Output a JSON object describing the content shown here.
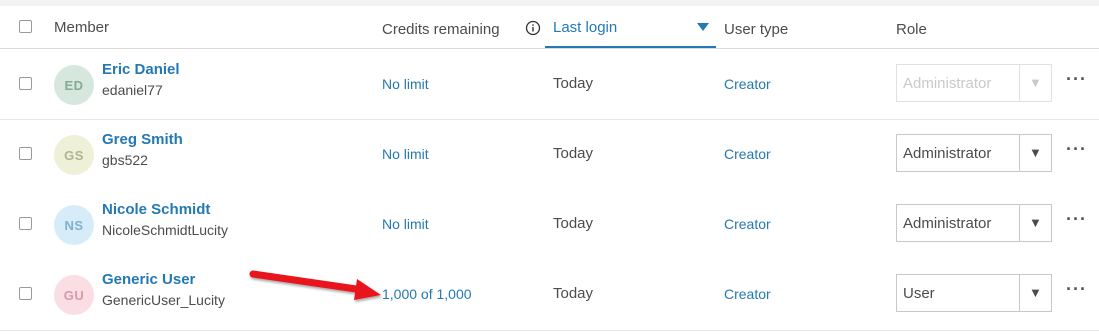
{
  "header": {
    "member": "Member",
    "credits_remaining": "Credits remaining",
    "last_login": "Last login",
    "user_type": "User type",
    "role": "Role"
  },
  "members": [
    {
      "initials": "ED",
      "full_name": "Eric Daniel",
      "username": "edaniel77",
      "credits": "No limit",
      "last_login": "Today",
      "user_type": "Creator",
      "role": "Administrator",
      "role_disabled": true,
      "avatar_bg": "#d6e8dd",
      "avatar_fg": "#86a994"
    },
    {
      "initials": "GS",
      "full_name": "Greg Smith",
      "username": "gbs522",
      "credits": "No limit",
      "last_login": "Today",
      "user_type": "Creator",
      "role": "Administrator",
      "role_disabled": false,
      "avatar_bg": "#eef0d8",
      "avatar_fg": "#b0b48f"
    },
    {
      "initials": "NS",
      "full_name": "Nicole Schmidt",
      "username": "NicoleSchmidtLucity",
      "credits": "No limit",
      "last_login": "Today",
      "user_type": "Creator",
      "role": "Administrator",
      "role_disabled": false,
      "avatar_bg": "#d6ecf8",
      "avatar_fg": "#7fb2cf"
    },
    {
      "initials": "GU",
      "full_name": "Generic User",
      "username": "GenericUser_Lucity",
      "credits": "1,000 of 1,000",
      "last_login": "Today",
      "user_type": "Creator",
      "role": "User",
      "role_disabled": false,
      "avatar_bg": "#fbdde4",
      "avatar_fg": "#d79aa9"
    }
  ],
  "icons": {
    "info": "info-circle-icon",
    "sort": "sort-descending-icon",
    "dropdown": "chevron-down-icon",
    "more": "more-horizontal-icon",
    "annotation": "red-arrow-annotation"
  },
  "colors": {
    "accent": "#2479b3",
    "annotation_arrow": "#e8161c"
  }
}
